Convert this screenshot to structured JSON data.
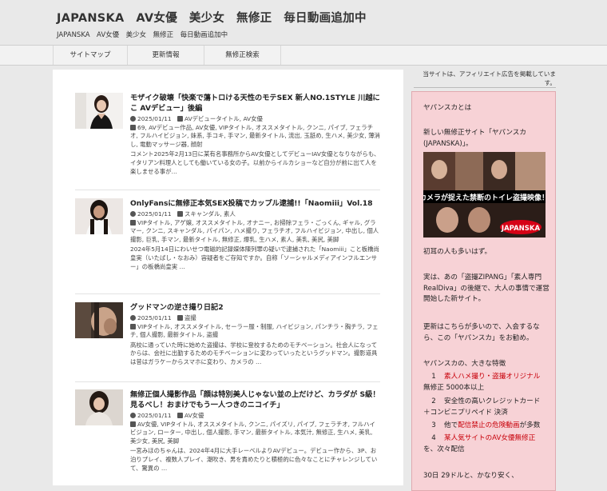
{
  "header": {
    "title": "JAPANSKA　AV女優　美少女　無修正　毎日動画追加中",
    "description": "JAPANSKA　AV女優　美少女　無修正　毎日動画追加中"
  },
  "nav": {
    "items": [
      "サイトマップ",
      "更新情報",
      "無修正検索"
    ]
  },
  "posts": [
    {
      "title": "モザイク破壊「快楽で蕩トロける天性のモテSEX 新人NO.1STYLE 川越にこ AVデビュー」後編",
      "date": "2025/01/11",
      "categories": "AVデビュータイトル, AV女優",
      "tags": "69, AVデビュー作品, AV女優, VIPタイトル, オススメタイトル, クンニ, パイブ, フェラチオ, フルハイビジョン, 妹系, 手コキ, 手マン, 最新タイトル, 流出, 玉舐め, 生ハメ, 美少女, 薄消し, 電動マッサージ器, 顔射",
      "excerpt": "コメント2025年2月13日に某有名事務所からAV女優としてデビューIAV女優となりながらも、イタリアン料理人としても働いている女の子。以前からイルカショーなど自分が前に出て人を楽しませる事が…"
    },
    {
      "title": "OnlyFansに無修正本気SEX投稿でカップル逮捕!!「Naomiii」Vol.18",
      "date": "2025/01/11",
      "categories": "スキャンダル, 素人",
      "tags": "VIPタイトル, アゲ嬢, オススメタイトル, オナニー, お掃除フェラ・ごっくん, ギャル, グラマー, クンニ, スキャンダル, パイパン, ハメ撮り, フェラチオ, フルハイビジョン, 中出し, 個人撮影, 巨乳, 手マン, 最新タイトル, 無修正, 爆乳, 生ハメ, 素人, 美乳, 美尻, 美脚",
      "excerpt": "2024年5月14日にわいせつ電磁的記録媒体陳列罪の疑いで逮捕された「Naomiii」こと板橋尚皇実（いたばし・なおみ）容疑者をご存知ですか。自称「ソーシャルメディアインフルエンサー」の板橋尚皇実 …"
    },
    {
      "title": "グッドマンの逆さ撮り日記2",
      "date": "2025/01/11",
      "categories": "盗撮",
      "tags": "VIPタイトル, オススメタイトル, セーラー服・制服, ハイビジョン, パンチラ・胸チラ, フェチ, 個人撮影, 最新タイトル, 盗撮",
      "excerpt": "高校に通っていた時に始めた盗撮は、学校に登校するためのモチベーション。社会人になってからは、会社に出勤するためのモチベーションに変わっていったというグッドマン。撮影道具は昔はガラケーからスマホに変わり、カメラの …"
    },
    {
      "title": "無修正個人撮影作品「顔は特別美人じゃない並の上だけど、カラダが S級！見るべし！おまけでもう一人つきのニコイチ」",
      "date": "2025/01/11",
      "categories": "AV女優",
      "tags": "AV女優, VIPタイトル, オススメタイトル, クンニ, パイズリ, パイブ, フェラチオ, フルハイビジョン, ローター, 中出し, 個人撮影, 手マン, 最新タイトル, 本気汁, 無修正, 生ハメ, 美乳, 美少女, 美尻, 美脚",
      "excerpt": "一宮みほのちゃんは、2024年4月に大手レーベルよりAVデビュー。デビュー作から、3P、お泊りプレイ、複数人プレイ、潮吹き、男を責めたりと積極的に色々なことにチャレンジしていて、驚異の …"
    }
  ],
  "sidebar": {
    "affiliate_note": "当サイトは、アフィリエイト広告を掲載しています。",
    "heading": "ヤパンスカとは",
    "intro": "新しい無修正サイト「ヤパンスカ(JAPANSKA)」。",
    "banner_alt": "JAPANSKA",
    "banner_caption": "カメラが捉えた禁断のトイレ盗撮映像！",
    "banner_logo": "JAPANSKA",
    "p1": "初耳の人も多いはず。",
    "p2": "実は、あの「盗撮ZIPANG」「素人専門RealDiva」の後継で、大人の事情で運営開始した新サイト。",
    "p3": "更新はこちらが多いので、入会するなら、この「ヤパンスカ」をお勧め。",
    "features_heading": "ヤパンスカの、大きな特徴",
    "f1_num": "1",
    "f1_text": "素人ハメ撮り・盗撮オリジナル",
    "f1_sub": "無修正 5000本以上",
    "f2_num": "2",
    "f2_text": "安全性の高いクレジットカード",
    "f2_sub": "＋コンビニプリペイド 決済",
    "f3_num": "3",
    "f3_pre": "他で",
    "f3_red": "配信禁止の危険動画",
    "f3_post": "が多数",
    "f4_num": "4",
    "f4_text": "某人気サイトのAV女優無修正",
    "f4_sub": "を、次々配信",
    "p4": "30日 29ドルと、かなり安く、"
  },
  "colors": {
    "sidebar_bg": "#f7d2d6",
    "accent_red": "#c8000a",
    "page_bg": "#e9e9e9"
  }
}
